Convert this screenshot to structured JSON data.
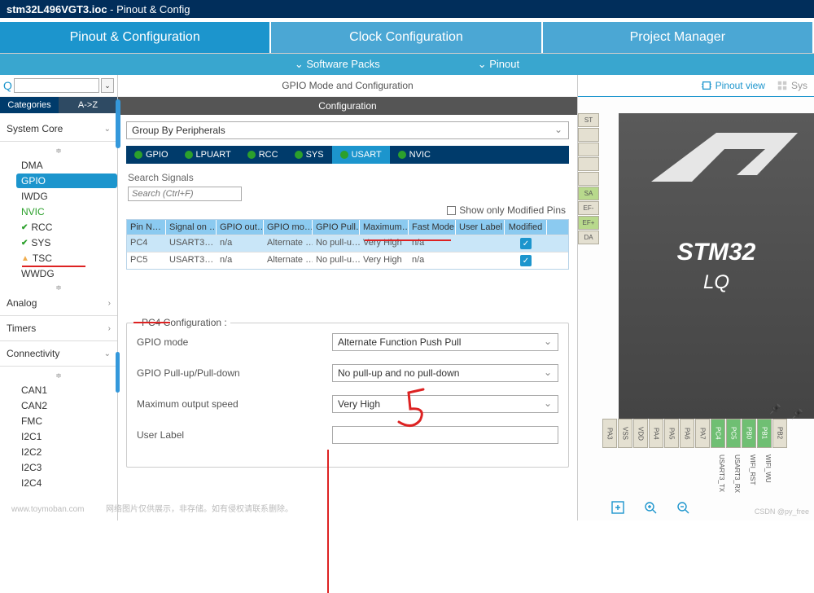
{
  "title": {
    "filename": "stm32L496VGT3.ioc",
    "page": "Pinout & Config"
  },
  "main_tabs": {
    "pinout": "Pinout & Configuration",
    "clock": "Clock Configuration",
    "project": "Project Manager"
  },
  "sub_bar": {
    "software": "Software Packs",
    "pinout": "Pinout"
  },
  "left": {
    "tabs": {
      "categories": "Categories",
      "az": "A->Z"
    },
    "sections": {
      "system": {
        "label": "System Core",
        "items": {
          "dma": "DMA",
          "gpio": "GPIO",
          "iwdg": "IWDG",
          "nvic": "NVIC",
          "rcc": "RCC",
          "sys": "SYS",
          "tsc": "TSC",
          "wwdg": "WWDG"
        }
      },
      "analog": "Analog",
      "timers": "Timers",
      "connectivity": "Connectivity",
      "conn_items": {
        "can1": "CAN1",
        "can2": "CAN2",
        "fmc": "FMC",
        "i2c1": "I2C1",
        "i2c2": "I2C2",
        "i2c3": "I2C3",
        "i2c4": "I2C4"
      }
    }
  },
  "middle": {
    "title": "GPIO Mode and Configuration",
    "config_header": "Configuration",
    "group_by": "Group By Peripherals",
    "periph_tabs": {
      "gpio": "GPIO",
      "lpuart": "LPUART",
      "rcc": "RCC",
      "sys": "SYS",
      "usart": "USART",
      "nvic": "NVIC"
    },
    "search": {
      "label": "Search Signals",
      "placeholder": "Search (Ctrl+F)"
    },
    "show_modified": "Show only Modified Pins",
    "grid": {
      "headers": {
        "pin": "Pin N…",
        "signal": "Signal on …",
        "out": "GPIO out…",
        "mode": "GPIO mo…",
        "pull": "GPIO Pull…",
        "max": "Maximum…",
        "fast": "Fast Mode",
        "user": "User Label",
        "mod": "Modified"
      },
      "rows": [
        {
          "pin": "PC4",
          "signal": "USART3…",
          "out": "n/a",
          "mode": "Alternate …",
          "pull": "No pull-u…",
          "max": "Very High",
          "fast": "n/a",
          "user": "",
          "mod": true
        },
        {
          "pin": "PC5",
          "signal": "USART3…",
          "out": "n/a",
          "mode": "Alternate …",
          "pull": "No pull-u…",
          "max": "Very High",
          "fast": "n/a",
          "user": "",
          "mod": true
        }
      ]
    },
    "form": {
      "legend": "PC4 Configuration :",
      "gpio_mode": {
        "label": "GPIO mode",
        "value": "Alternate Function Push Pull"
      },
      "pull": {
        "label": "GPIO Pull-up/Pull-down",
        "value": "No pull-up and no pull-down"
      },
      "speed": {
        "label": "Maximum output speed",
        "value": "Very High"
      },
      "user_label": {
        "label": "User Label",
        "value": ""
      }
    }
  },
  "right": {
    "pinout_view": "Pinout view",
    "system_view": "Sys",
    "chip": {
      "name": "STM32",
      "pkg": "LQ"
    },
    "pins_left": [
      "ST",
      "",
      "",
      "",
      "",
      "SA",
      "EF-",
      "EF+",
      "DA"
    ],
    "pins_bottom": [
      "PA3",
      "VSS",
      "VDD",
      "PA4",
      "PA5",
      "PA6",
      "PA7",
      "PC4",
      "PC5",
      "PB0",
      "PB1",
      "PB2"
    ],
    "pin_labels": [
      "",
      "",
      "",
      "",
      "",
      "",
      "",
      "USART3_TX",
      "USART3_RX",
      "WIFI_RST",
      "WIFI_WU",
      ""
    ]
  },
  "footer": {
    "wm_left": "www.toymoban.com",
    "caption": "网络图片仅供展示，非存储。如有侵权请联系删除。",
    "wm_right": "CSDN @py_free"
  }
}
